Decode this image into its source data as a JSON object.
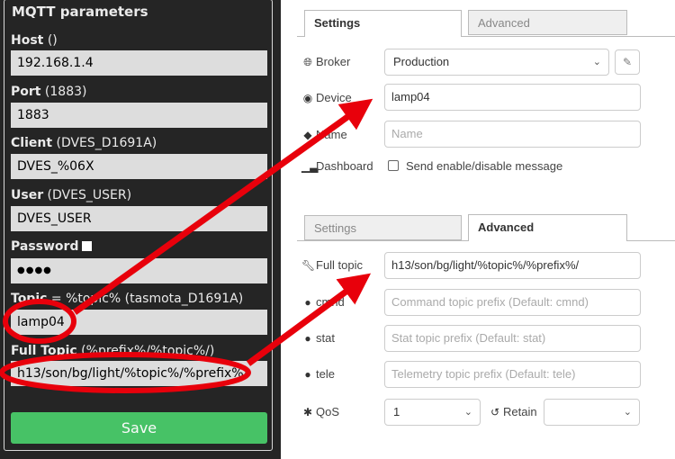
{
  "tasmota": {
    "legend": "MQTT parameters",
    "host": {
      "label": "Host",
      "hint": " ()",
      "value": "192.168.1.4"
    },
    "port": {
      "label": "Port",
      "hint": " (1883)",
      "value": "1883"
    },
    "client": {
      "label": "Client",
      "hint": " (DVES_D1691A)",
      "value": "DVES_%06X"
    },
    "user": {
      "label": "User",
      "hint": " (DVES_USER)",
      "value": "DVES_USER"
    },
    "password": {
      "label": "Password",
      "value": "●●●●"
    },
    "topic": {
      "label": "Topic",
      "hint": " = %topic% (tasmota_D1691A)",
      "value": "lamp04"
    },
    "full_topic": {
      "label": "Full Topic",
      "hint": " (%prefix%/%topic%/)",
      "value": "h13/son/bg/light/%topic%/%prefix%/"
    },
    "save_label": "Save"
  },
  "node_config_top": {
    "tabs": [
      {
        "label": "Settings",
        "active": true
      },
      {
        "label": "Advanced",
        "active": false
      }
    ],
    "broker": {
      "label": "Broker",
      "value": "Production"
    },
    "device": {
      "label": "Device",
      "value": "lamp04"
    },
    "name": {
      "label": "Name",
      "placeholder": "Name"
    },
    "dashboard": {
      "label": "Dashboard",
      "checkbox_label": "Send enable/disable message"
    }
  },
  "node_config_bottom": {
    "tabs": [
      {
        "label": "Settings",
        "active": false
      },
      {
        "label": "Advanced",
        "active": true
      }
    ],
    "full_topic": {
      "label": "Full topic",
      "value": "h13/son/bg/light/%topic%/%prefix%/"
    },
    "cmnd": {
      "label": "cmnd",
      "placeholder": "Command topic prefix (Default: cmnd)"
    },
    "stat": {
      "label": "stat",
      "placeholder": "Stat topic prefix (Default: stat)"
    },
    "tele": {
      "label": "tele",
      "placeholder": "Telemetry topic prefix (Default: tele)"
    },
    "qos": {
      "label": "QoS",
      "value": "1"
    },
    "retain": {
      "label": "Retain",
      "value": ""
    }
  },
  "colors": {
    "panel_bg": "#252525",
    "input_bg": "#dddddd",
    "save_green": "#47c266",
    "annotation_red": "#e8000b"
  },
  "icons": {
    "broker": "globe-icon",
    "device": "target-icon",
    "name": "tag-icon",
    "dashboard": "bar-chart-icon",
    "full_topic": "wrench-icon",
    "prefix": "comment-icon",
    "qos": "asterisk-icon",
    "retain": "history-icon"
  }
}
